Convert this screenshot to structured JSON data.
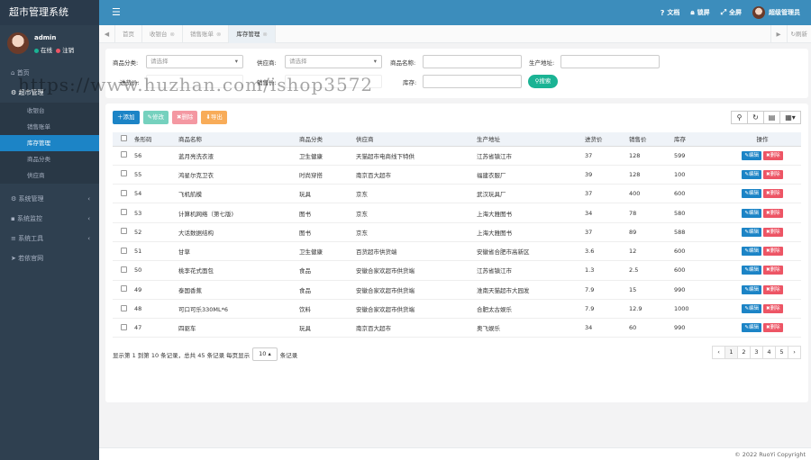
{
  "app": {
    "title": "超市管理系统"
  },
  "user": {
    "name": "admin",
    "online": "在线",
    "logout": "注销"
  },
  "sidebar": {
    "items": [
      {
        "label": "首页",
        "icon": "home-icon"
      },
      {
        "label": "超市管理",
        "icon": "cart-icon",
        "children": [
          "收银台",
          "销售账单",
          "库存管理",
          "商品分类",
          "供应商"
        ],
        "active_child": 2
      },
      {
        "label": "系统管理",
        "icon": "gear-icon"
      },
      {
        "label": "系统监控",
        "icon": "video-icon"
      },
      {
        "label": "系统工具",
        "icon": "bars-icon"
      },
      {
        "label": "若依官网",
        "icon": "send-icon"
      }
    ]
  },
  "topbar": {
    "docs": "文档",
    "lock": "锁屏",
    "fullscreen": "全屏",
    "role": "超级管理员"
  },
  "tabs": [
    {
      "label": "首页"
    },
    {
      "label": "收银台"
    },
    {
      "label": "销售账单"
    },
    {
      "label": "库存管理",
      "active": true
    }
  ],
  "refresh": "刷新",
  "search": {
    "category_label": "商品分类:",
    "category_placeholder": "请选择",
    "supplier_label": "供应商:",
    "supplier_placeholder": "请选择",
    "name_label": "商品名称:",
    "address_label": "生产地址:",
    "purchase_label": "进货价:",
    "sale_label": "销售价:",
    "stock_label": "库存:",
    "button": "搜索"
  },
  "toolbar": {
    "add": "添加",
    "edit": "修改",
    "delete": "删除",
    "export": "导出"
  },
  "table": {
    "headers": [
      "条形码",
      "商品名称",
      "商品分类",
      "供应商",
      "生产地址",
      "进货价",
      "销售价",
      "库存",
      "操作"
    ],
    "op_edit": "编辑",
    "op_delete": "删除",
    "rows": [
      [
        "56",
        "蓝月亮洗衣液",
        "卫生健康",
        "天猫超市电商线下特供",
        "江苏省镇江市",
        "37",
        "128",
        "599"
      ],
      [
        "55",
        "鸿星尔克卫衣",
        "时尚穿搭",
        "南京百大超市",
        "福建衣服厂",
        "39",
        "128",
        "100"
      ],
      [
        "54",
        "飞机航模",
        "玩具",
        "京东",
        "武汉玩具厂",
        "37",
        "400",
        "600"
      ],
      [
        "53",
        "计算机网络（第七版)",
        "图书",
        "京东",
        "上海大雅图书",
        "34",
        "78",
        "580"
      ],
      [
        "52",
        "大话数据结构",
        "图书",
        "京东",
        "上海大雅图书",
        "37",
        "89",
        "588"
      ],
      [
        "51",
        "甘草",
        "卫生健康",
        "百货超市供货端",
        "安徽省合肥市高新区",
        "3.6",
        "12",
        "600"
      ],
      [
        "50",
        "桃李花式面包",
        "食品",
        "安徽合家欢超市供货端",
        "江苏省镇江市",
        "1.3",
        "2.5",
        "600"
      ],
      [
        "49",
        "泰国香蕉",
        "食品",
        "安徽合家欢超市供货端",
        "淮南天猫超市大园发",
        "7.9",
        "15",
        "990"
      ],
      [
        "48",
        "可口可乐330ML*6",
        "饮料",
        "安徽合家欢超市供货端",
        "合肥太古娱乐",
        "7.9",
        "12.9",
        "1000"
      ],
      [
        "47",
        "四驱车",
        "玩具",
        "南京百大超市",
        "奥飞娱乐",
        "34",
        "60",
        "990"
      ]
    ]
  },
  "pager": {
    "info": "显示第 1 到第 10 条记录，总共 45 条记录",
    "per_page_prefix": "每页显示",
    "per_page": "10",
    "per_page_suffix": "条记录",
    "pages": [
      "‹",
      "1",
      "2",
      "3",
      "4",
      "5",
      "›"
    ],
    "active_page": "1"
  },
  "footer": "© 2022 RuoYi Copyright",
  "watermark": "https://www.huzhan.com/ishop3572",
  "colors": {
    "sidebar": "#2f4050",
    "topbar": "#3c8dbc",
    "accent": "#1c84c6",
    "success": "#1ab394",
    "danger": "#ed5565",
    "warning": "#f8ac59"
  }
}
